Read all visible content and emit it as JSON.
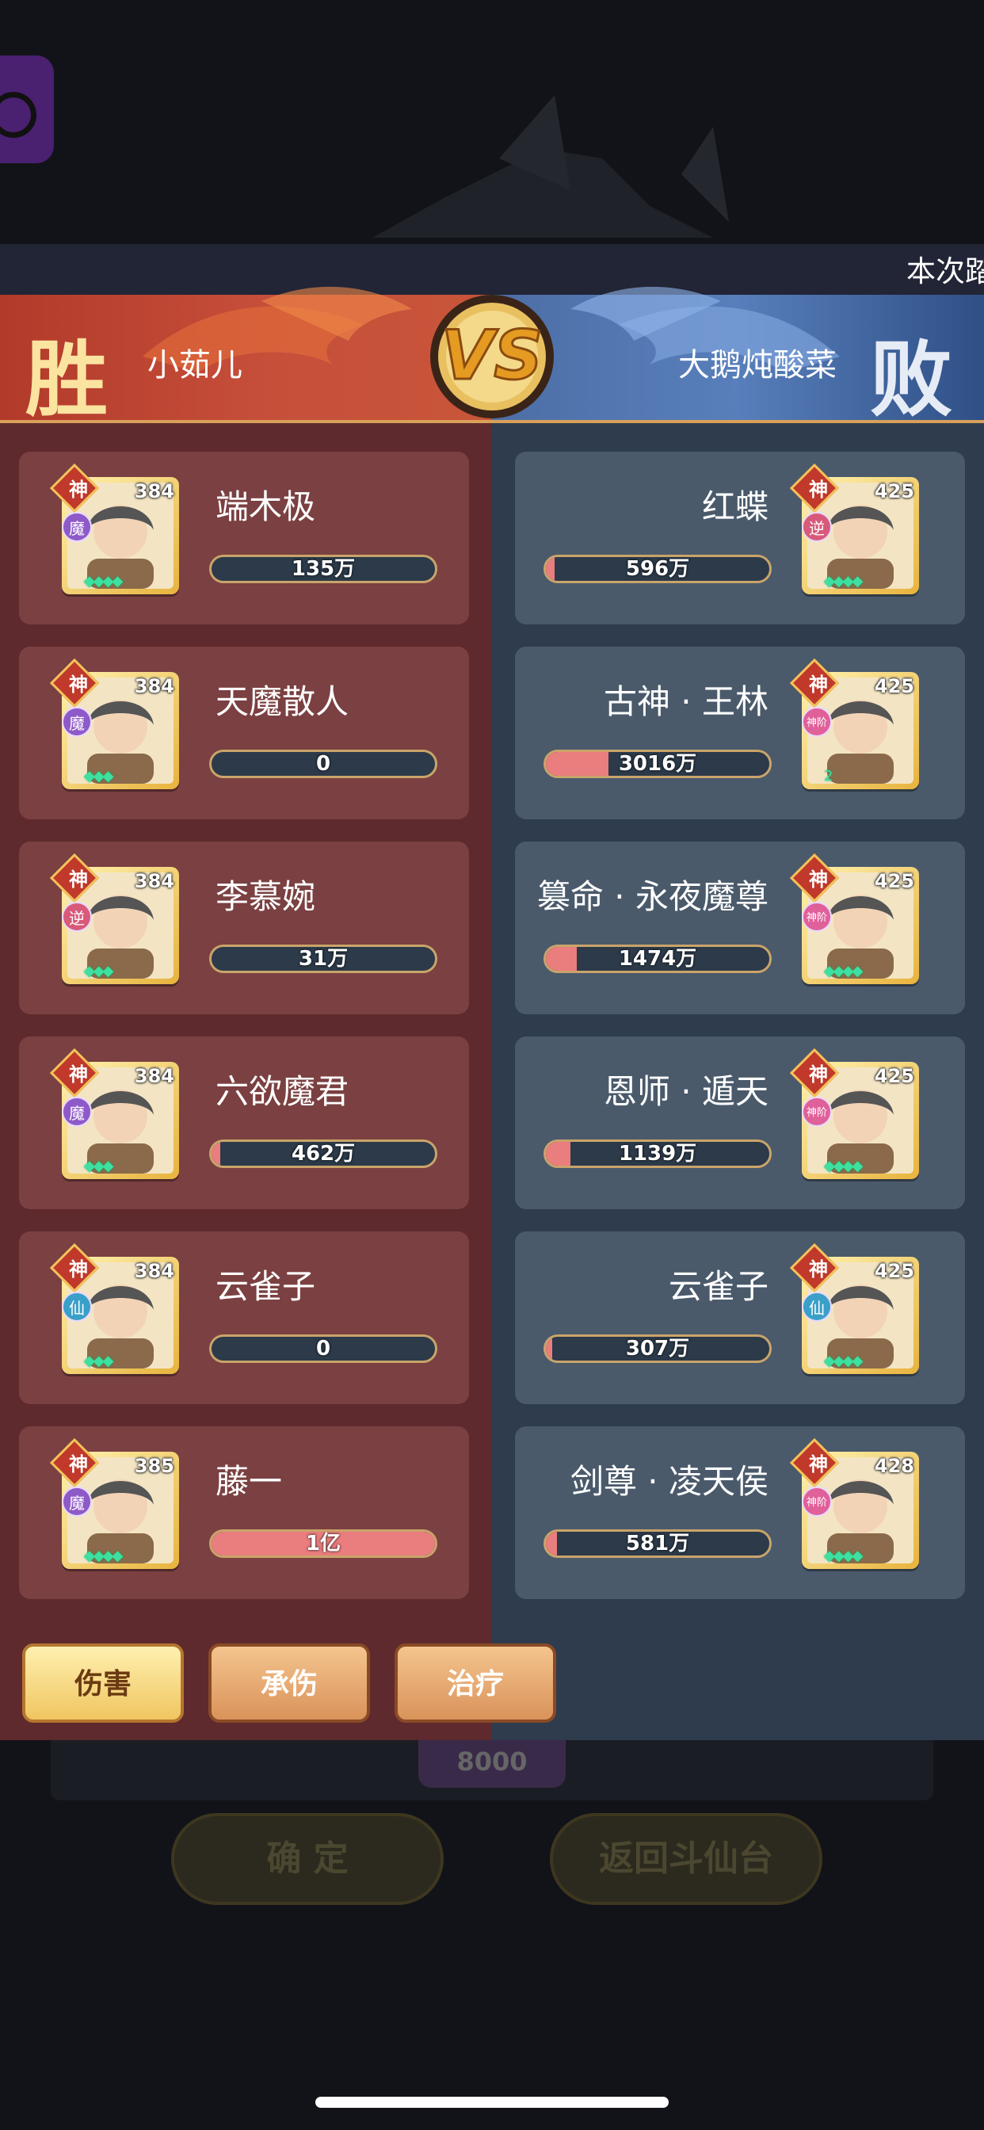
{
  "top_banner": {
    "text": "本次踏"
  },
  "header": {
    "win_badge": "胜",
    "lose_badge": "败",
    "vs_label": "VS",
    "left_player": "小茹儿",
    "right_player": "大鹅炖酸菜"
  },
  "left_team": [
    {
      "name": "端木极",
      "rank": "神",
      "faction": "魔",
      "faction_color": "#8e5ac8",
      "level": "384",
      "stars": "◆◆◆◆",
      "value": "135万",
      "fill": 0.0
    },
    {
      "name": "天魔散人",
      "rank": "神",
      "faction": "魔",
      "faction_color": "#8e5ac8",
      "level": "384",
      "stars": "◆◆◆",
      "value": "0",
      "fill": 0.0
    },
    {
      "name": "李慕婉",
      "rank": "神",
      "faction": "逆",
      "faction_color": "#d85a7a",
      "level": "384",
      "stars": "◆◆◆",
      "value": "31万",
      "fill": 0.0
    },
    {
      "name": "六欲魔君",
      "rank": "神",
      "faction": "魔",
      "faction_color": "#8e5ac8",
      "level": "384",
      "stars": "◆◆◆",
      "value": "462万",
      "fill": 0.04
    },
    {
      "name": "云雀子",
      "rank": "神",
      "faction": "仙",
      "faction_color": "#3aa0c8",
      "level": "384",
      "stars": "◆◆◆",
      "value": "0",
      "fill": 0.0
    },
    {
      "name": "藤一",
      "rank": "神",
      "faction": "魔",
      "faction_color": "#8e5ac8",
      "level": "385",
      "stars": "◆◆◆◆",
      "value": "1亿",
      "fill": 1.0
    }
  ],
  "right_team": [
    {
      "name": "红蝶",
      "rank": "神",
      "faction": "逆",
      "faction_color": "#d85a7a",
      "level": "425",
      "stars": "◆◆◆◆",
      "value": "596万",
      "fill": 0.04
    },
    {
      "name": "古神 · 王林",
      "rank": "神",
      "faction": "神阶",
      "faction_color": "#e0609a",
      "level": "425",
      "stars": "2",
      "value": "3016万",
      "fill": 0.28
    },
    {
      "name": "篡命 · 永夜魔尊",
      "rank": "神",
      "faction": "神阶",
      "faction_color": "#e0609a",
      "level": "425",
      "stars": "◆◆◆◆",
      "value": "1474万",
      "fill": 0.14
    },
    {
      "name": "恩师 · 遁天",
      "rank": "神",
      "faction": "神阶",
      "faction_color": "#e0609a",
      "level": "425",
      "stars": "◆◆◆◆",
      "value": "1139万",
      "fill": 0.11
    },
    {
      "name": "云雀子",
      "rank": "神",
      "faction": "仙",
      "faction_color": "#3aa0c8",
      "level": "425",
      "stars": "◆◆◆◆",
      "value": "307万",
      "fill": 0.03
    },
    {
      "name": "剑尊 · 凌天侯",
      "rank": "神",
      "faction": "神阶",
      "faction_color": "#e0609a",
      "level": "428",
      "stars": "◆◆◆◆",
      "value": "581万",
      "fill": 0.05
    }
  ],
  "tabs": {
    "damage": "伤害",
    "taken": "承伤",
    "heal": "治疗"
  },
  "behind": {
    "gem_value": "8000",
    "confirm_label": "确 定",
    "return_label": "返回斗仙台"
  }
}
